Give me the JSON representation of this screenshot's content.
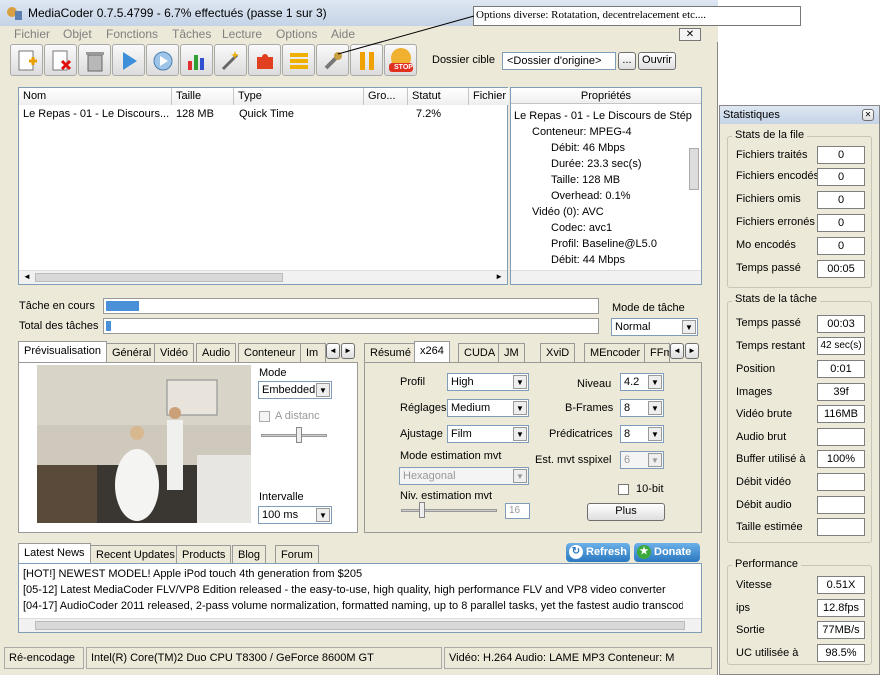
{
  "window": {
    "title": "MediaCoder 0.7.5.4799 -  6.7% effectués (passe 1 sur 3)"
  },
  "menu": [
    "Fichier",
    "Objet",
    "Fonctions",
    "Tâches",
    "Lecture",
    "Options",
    "Aide"
  ],
  "tooltip": "Options diverse: Rotatation, decentrelacement etc....",
  "toolbar": {
    "dest_label": "Dossier cible",
    "dest_value": "<Dossier d'origine>",
    "browse_label": "...",
    "open_label": "Ouvrir",
    "stop_label": "STOP"
  },
  "filelist": {
    "columns": [
      "Nom",
      "Taille",
      "Type",
      "Gro...",
      "Statut",
      "Fichier"
    ],
    "rows": [
      {
        "name": "Le Repas - 01 - Le Discours...",
        "size": "128 MB",
        "type": "Quick Time",
        "group": "",
        "status": "7.2%",
        "file": ""
      }
    ]
  },
  "properties": {
    "header": "Propriétés",
    "lines": [
      "Le Repas - 01 - Le Discours de Stép",
      "Conteneur: MPEG-4",
      "Débit: 46 Mbps",
      "Durée: 23.3 sec(s)",
      "Taille: 128 MB",
      "Overhead: 0.1%",
      "Vidéo (0): AVC",
      "Codec: avc1",
      "Profil: Baseline@L5.0",
      "Débit: 44 Mbps"
    ]
  },
  "progress": {
    "current_label": "Tâche en cours",
    "total_label": "Total des tâches",
    "current_fraction": 0.067,
    "total_fraction": 0.011
  },
  "task_mode": {
    "label": "Mode de tâche",
    "value": "Normal"
  },
  "left_tabs": [
    "Prévisualisation",
    "Général",
    "Vidéo",
    "Audio",
    "Conteneur",
    "Im"
  ],
  "preview": {
    "mode_label": "Mode",
    "mode_value": "Embedded",
    "distance_label": "A distanc",
    "interval_label": "Intervalle",
    "interval_value": "100 ms"
  },
  "right_tabs": [
    "Résumé",
    "x264",
    "CUDA",
    "JM",
    "XviD",
    "MEncoder",
    "FFm"
  ],
  "x264": {
    "profil_label": "Profil",
    "profil_value": "High",
    "reglages_label": "Réglages",
    "reglages_value": "Medium",
    "ajustage_label": "Ajustage",
    "ajustage_value": "Film",
    "niveau_label": "Niveau",
    "niveau_value": "4.2",
    "bframes_label": "B-Frames",
    "bframes_value": "8",
    "predic_label": "Prédicatrices",
    "predic_value": "8",
    "me_label": "Mode estimation mvt",
    "me_value": "Hexagonal",
    "subpix_label": "Est. mvt sspixel",
    "subpix_value": "6",
    "merange_label": "Niv. estimation mvt",
    "merange_value": "16",
    "tenbit_label": "10-bit",
    "plus_label": "Plus"
  },
  "news": {
    "tabs": [
      "Latest News",
      "Recent Updates",
      "Products",
      "Blog",
      "Forum"
    ],
    "refresh_label": "Refresh",
    "donate_label": "Donate",
    "lines": [
      "[HOT!] NEWEST MODEL! Apple iPod touch 4th generation from $205",
      "[05-12] Latest MediaCoder FLV/VP8 Edition released - the easy-to-use, high quality, high performance FLV and VP8 video converter",
      "[04-17] AudioCoder 2011 released, 2-pass volume normalization, formatted naming, up to 8 parallel tasks, yet the fastest audio transcod"
    ]
  },
  "statusbar": {
    "state": "Ré-encodage",
    "cpu": "Intel(R) Core(TM)2 Duo CPU T8300  / GeForce 8600M GT",
    "format": "Vidéo: H.264  Audio: LAME MP3  Conteneur: M"
  },
  "stats": {
    "title": "Statistiques",
    "queue_title": "Stats de la file",
    "queue": [
      {
        "label": "Fichiers traités",
        "value": "0"
      },
      {
        "label": "Fichiers encodés",
        "value": "0"
      },
      {
        "label": "Fichiers omis",
        "value": "0"
      },
      {
        "label": "Fichiers erronés",
        "value": "0"
      },
      {
        "label": "Mo encodés",
        "value": "0"
      },
      {
        "label": "Temps passé",
        "value": "00:05"
      }
    ],
    "task_title": "Stats de la tâche",
    "task": [
      {
        "label": "Temps passé",
        "value": "00:03"
      },
      {
        "label": "Temps restant",
        "value": "42 sec(s)"
      },
      {
        "label": "Position",
        "value": "0:01"
      },
      {
        "label": "Images",
        "value": "39f"
      },
      {
        "label": "Vidéo brute",
        "value": "116MB"
      },
      {
        "label": "Audio brut",
        "value": ""
      },
      {
        "label": "Buffer utilisé à",
        "value": "100%"
      },
      {
        "label": "Débit vidéo",
        "value": ""
      },
      {
        "label": "Débit audio",
        "value": ""
      },
      {
        "label": "Taille estimée",
        "value": ""
      }
    ],
    "perf_title": "Performance",
    "perf": [
      {
        "label": "Vitesse",
        "value": "0.51X"
      },
      {
        "label": "ips",
        "value": "12.8fps"
      },
      {
        "label": "Sortie",
        "value": "77MB/s"
      },
      {
        "label": "UC utilisée à",
        "value": "98.5%"
      }
    ]
  }
}
